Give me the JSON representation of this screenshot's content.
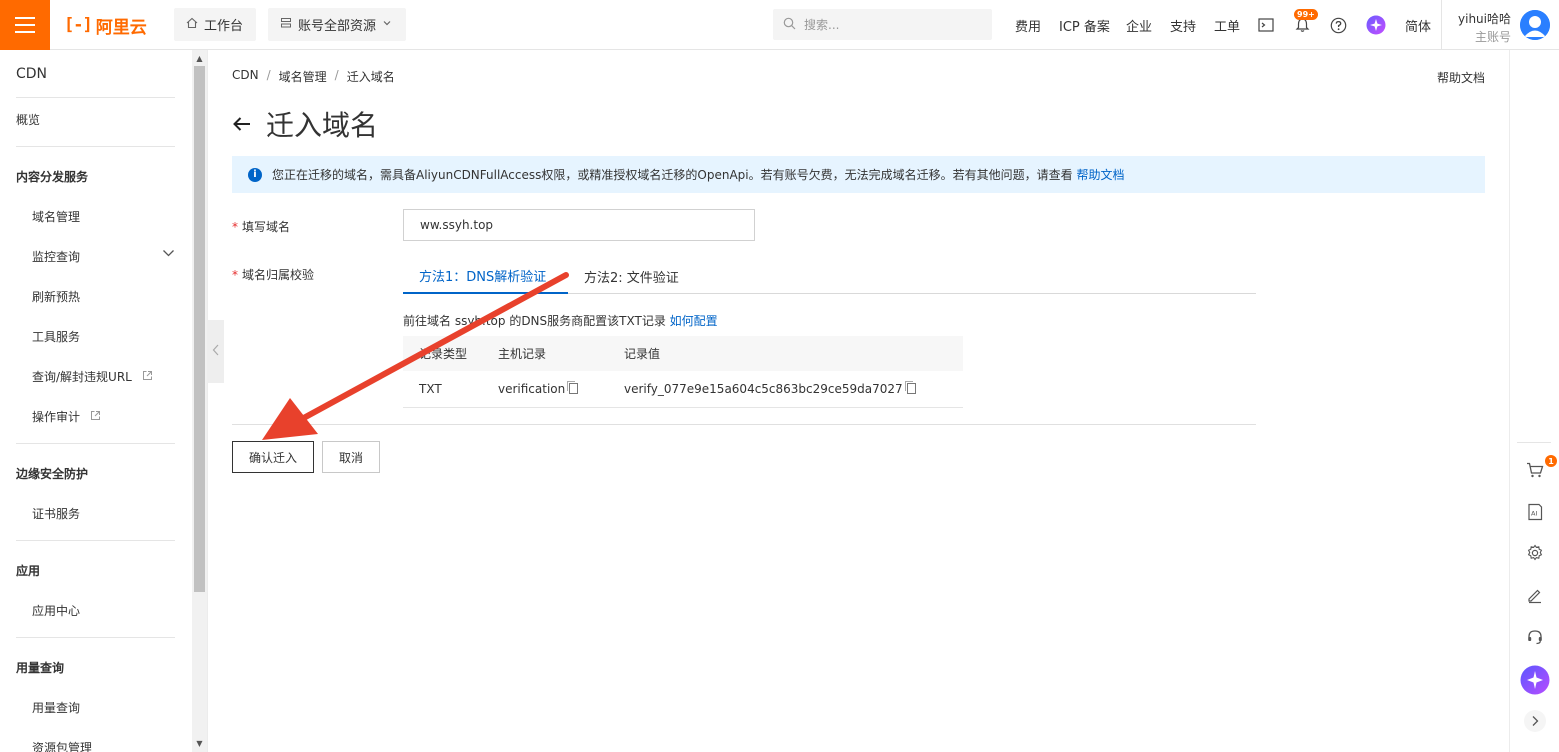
{
  "topbar": {
    "logo_text": "阿里云",
    "workbench_label": "工作台",
    "resources_label": "账号全部资源",
    "search_placeholder": "搜索...",
    "nav": [
      "费用",
      "ICP 备案",
      "企业",
      "支持",
      "工单"
    ],
    "notification_badge": "99+",
    "language_label": "简体",
    "user_name": "yihui哈哈",
    "user_role": "主账号",
    "brand_color": "#ff6a00"
  },
  "sidebar": {
    "title": "CDN",
    "overview": "概览",
    "groups": {
      "content": "内容分发服务",
      "security": "边缘安全防护",
      "apps": "应用",
      "usage": "用量查询"
    },
    "items": {
      "domain_mgmt": "域名管理",
      "monitor": "监控查询",
      "refresh": "刷新预热",
      "tools": "工具服务",
      "url_query": "查询/解封违规URL",
      "audit": "操作审计",
      "cert": "证书服务",
      "app_center": "应用中心",
      "usage_query": "用量查询",
      "package_mgmt": "资源包管理"
    }
  },
  "breadcrumb": [
    "CDN",
    "域名管理",
    "迁入域名"
  ],
  "help_doc": "帮助文档",
  "page_title": "迁入域名",
  "notice": {
    "text": "您正在迁移的域名，需具备AliyunCDNFullAccess权限，或精准授权域名迁移的OpenApi。若有账号欠费，无法完成域名迁移。若有其他问题，请查看",
    "link": "帮助文档"
  },
  "form": {
    "domain_label": "填写域名",
    "domain_value": "ww.ssyh.top",
    "verify_label": "域名归属校验",
    "tabs": [
      "方法1：DNS解析验证",
      "方法2: 文件验证"
    ],
    "dns_hint": "前往域名 ssyh.top 的DNS服务商配置该TXT记录",
    "dns_hint_link": "如何配置",
    "table": {
      "headers": [
        "记录类型",
        "主机记录",
        "记录值"
      ],
      "rows": [
        [
          "TXT",
          "verification",
          "verify_077e9e15a604c5c863bc29ce59da7027"
        ]
      ]
    },
    "confirm_label": "确认迁入",
    "cancel_label": "取消"
  },
  "right_rail": {
    "cart_badge": "1"
  },
  "annotation_color": "#e8412c"
}
